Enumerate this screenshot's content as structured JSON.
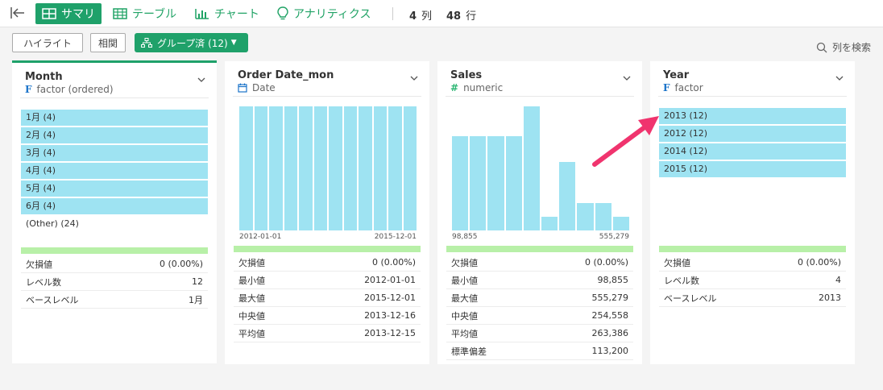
{
  "toolbar": {
    "tabs": [
      {
        "label": "サマリ",
        "icon": "grid-icon",
        "active": true
      },
      {
        "label": "テーブル",
        "icon": "table-icon",
        "active": false
      },
      {
        "label": "チャート",
        "icon": "bar-chart-icon",
        "active": false
      },
      {
        "label": "アナリティクス",
        "icon": "lightbulb-icon",
        "active": false
      }
    ],
    "columns_count": "4",
    "columns_unit": "列",
    "rows_count": "48",
    "rows_unit": "行"
  },
  "subbar": {
    "highlight_label": "ハイライト",
    "correlation_label": "相関",
    "grouped_label": "グループ済 (12)",
    "search_label": "列を検索"
  },
  "colors": {
    "accent": "#1fa16a",
    "bar": "#9ee3f2",
    "quality": "#b8f0a8",
    "arrow": "#f0346e"
  },
  "cards": [
    {
      "name": "Month",
      "type": "factor (ordered)",
      "type_icon": "F",
      "items": [
        "1月 (4)",
        "2月 (4)",
        "3月 (4)",
        "4月 (4)",
        "5月 (4)",
        "6月 (4)"
      ],
      "other": "(Other) (24)",
      "stats": [
        {
          "label": "欠損値",
          "value": "0 (0.00%)"
        },
        {
          "label": "レベル数",
          "value": "12"
        },
        {
          "label": "ベースレベル",
          "value": "1月"
        }
      ]
    },
    {
      "name": "Order Date_mon",
      "type": "Date",
      "type_icon": "calendar-icon",
      "histogram": [
        1,
        1,
        1,
        1,
        1,
        1,
        1,
        1,
        1,
        1,
        1,
        1
      ],
      "axis_min": "2012-01-01",
      "axis_max": "2015-12-01",
      "stats": [
        {
          "label": "欠損値",
          "value": "0 (0.00%)"
        },
        {
          "label": "最小値",
          "value": "2012-01-01"
        },
        {
          "label": "最大値",
          "value": "2015-12-01"
        },
        {
          "label": "中央値",
          "value": "2013-12-16"
        },
        {
          "label": "平均値",
          "value": "2013-12-15"
        }
      ]
    },
    {
      "name": "Sales",
      "type": "numeric",
      "type_icon": "#",
      "histogram": [
        0.76,
        0.76,
        0.76,
        0.76,
        1.0,
        0.11,
        0.55,
        0.22,
        0.22,
        0.11
      ],
      "axis_min": "98,855",
      "axis_max": "555,279",
      "stats": [
        {
          "label": "欠損値",
          "value": "0 (0.00%)"
        },
        {
          "label": "最小値",
          "value": "98,855"
        },
        {
          "label": "最大値",
          "value": "555,279"
        },
        {
          "label": "中央値",
          "value": "254,558"
        },
        {
          "label": "平均値",
          "value": "263,386"
        },
        {
          "label": "標準偏差",
          "value": "113,200"
        }
      ]
    },
    {
      "name": "Year",
      "type": "factor",
      "type_icon": "F",
      "items": [
        "2013 (12)",
        "2012 (12)",
        "2014 (12)",
        "2015 (12)"
      ],
      "stats": [
        {
          "label": "欠損値",
          "value": "0 (0.00%)"
        },
        {
          "label": "レベル数",
          "value": "4"
        },
        {
          "label": "ベースレベル",
          "value": "2013"
        }
      ]
    }
  ]
}
